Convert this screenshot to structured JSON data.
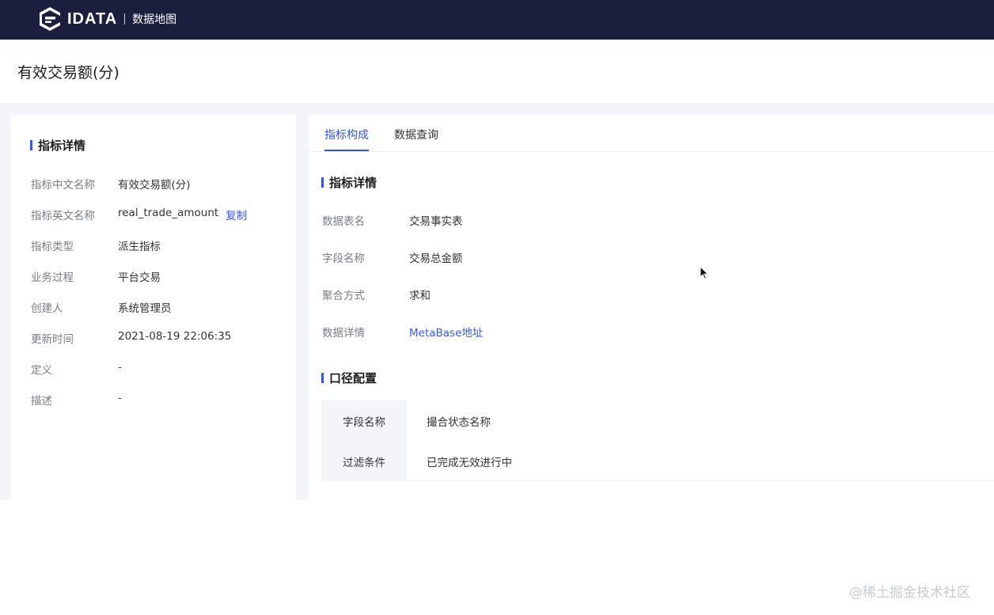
{
  "header": {
    "logo_text": "IDATA",
    "subtitle": "数据地图"
  },
  "page": {
    "title": "有效交易额(分)"
  },
  "metric_detail": {
    "heading": "指标详情",
    "rows": [
      {
        "label": "指标中文名称",
        "value": "有效交易额(分)"
      },
      {
        "label": "指标英文名称",
        "value": "real_trade_amount",
        "action": "复制"
      },
      {
        "label": "指标类型",
        "value": "派生指标"
      },
      {
        "label": "业务过程",
        "value": "平台交易"
      },
      {
        "label": "创建人",
        "value": "系统管理员"
      },
      {
        "label": "更新时间",
        "value": "2021-08-19 22:06:35"
      },
      {
        "label": "定义",
        "value": "-"
      },
      {
        "label": "描述",
        "value": "-"
      }
    ]
  },
  "tabs": [
    {
      "label": "指标构成",
      "active": true
    },
    {
      "label": "数据查询",
      "active": false
    }
  ],
  "composition": {
    "heading": "指标详情",
    "rows": [
      {
        "label": "数据表名",
        "value": "交易事实表"
      },
      {
        "label": "字段名称",
        "value": "交易总金额"
      },
      {
        "label": "聚合方式",
        "value": "求和"
      },
      {
        "label": "数据详情",
        "value": "MetaBase地址"
      }
    ]
  },
  "caliber": {
    "heading": "口径配置",
    "rows": [
      {
        "label": "字段名称",
        "value": "撮合状态名称"
      },
      {
        "label": "过滤条件",
        "value": "已完成无效进行中"
      }
    ]
  },
  "watermark": "@稀土掘金技术社区",
  "colors": {
    "topbar": "#1b1e3c",
    "accent": "#3856d6",
    "link": "#3a5bd9",
    "background": "#f3f5f9"
  }
}
